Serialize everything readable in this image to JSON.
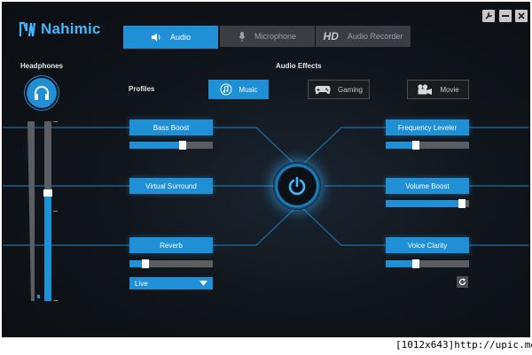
{
  "app": {
    "name": "Nahimic"
  },
  "window_controls": {
    "settings_icon": "wrench-icon",
    "minimize_icon": "minus-icon",
    "close_icon": "close-icon"
  },
  "tabs": [
    {
      "label": "Audio",
      "icon": "speaker-icon",
      "active": true
    },
    {
      "label": "Microphone",
      "icon": "microphone-icon",
      "active": false
    },
    {
      "label": "Audio Recorder",
      "prefix": "HD",
      "active": false
    }
  ],
  "device": {
    "title": "Headphones",
    "icon": "headphones-icon",
    "volume_level": 0.6
  },
  "audio_effects": {
    "title": "Audio Effects",
    "profiles_label": "Profiles",
    "profiles": [
      {
        "label": "Music",
        "icon": "music-note-icon",
        "active": true
      },
      {
        "label": "Gaming",
        "icon": "gamepad-icon",
        "active": false
      },
      {
        "label": "Movie",
        "icon": "movie-camera-icon",
        "active": false
      }
    ],
    "left": [
      {
        "label": "Bass Boost",
        "level": 0.65
      },
      {
        "label": "Virtual Surround"
      },
      {
        "label": "Reverb",
        "level": 0.16,
        "preset": "Live"
      }
    ],
    "right": [
      {
        "label": "Frequency Leveler",
        "level": 0.35
      },
      {
        "label": "Volume Boost",
        "level": 0.95
      },
      {
        "label": "Voice Clarity",
        "level": 0.35
      }
    ],
    "power_icon": "power-icon",
    "reset_icon": "refresh-icon"
  },
  "colors": {
    "accent": "#1f8fd6",
    "glow": "#3fb8ff",
    "background": "#0b0e12"
  },
  "watermark": "[1012x643]http://upic.me/"
}
